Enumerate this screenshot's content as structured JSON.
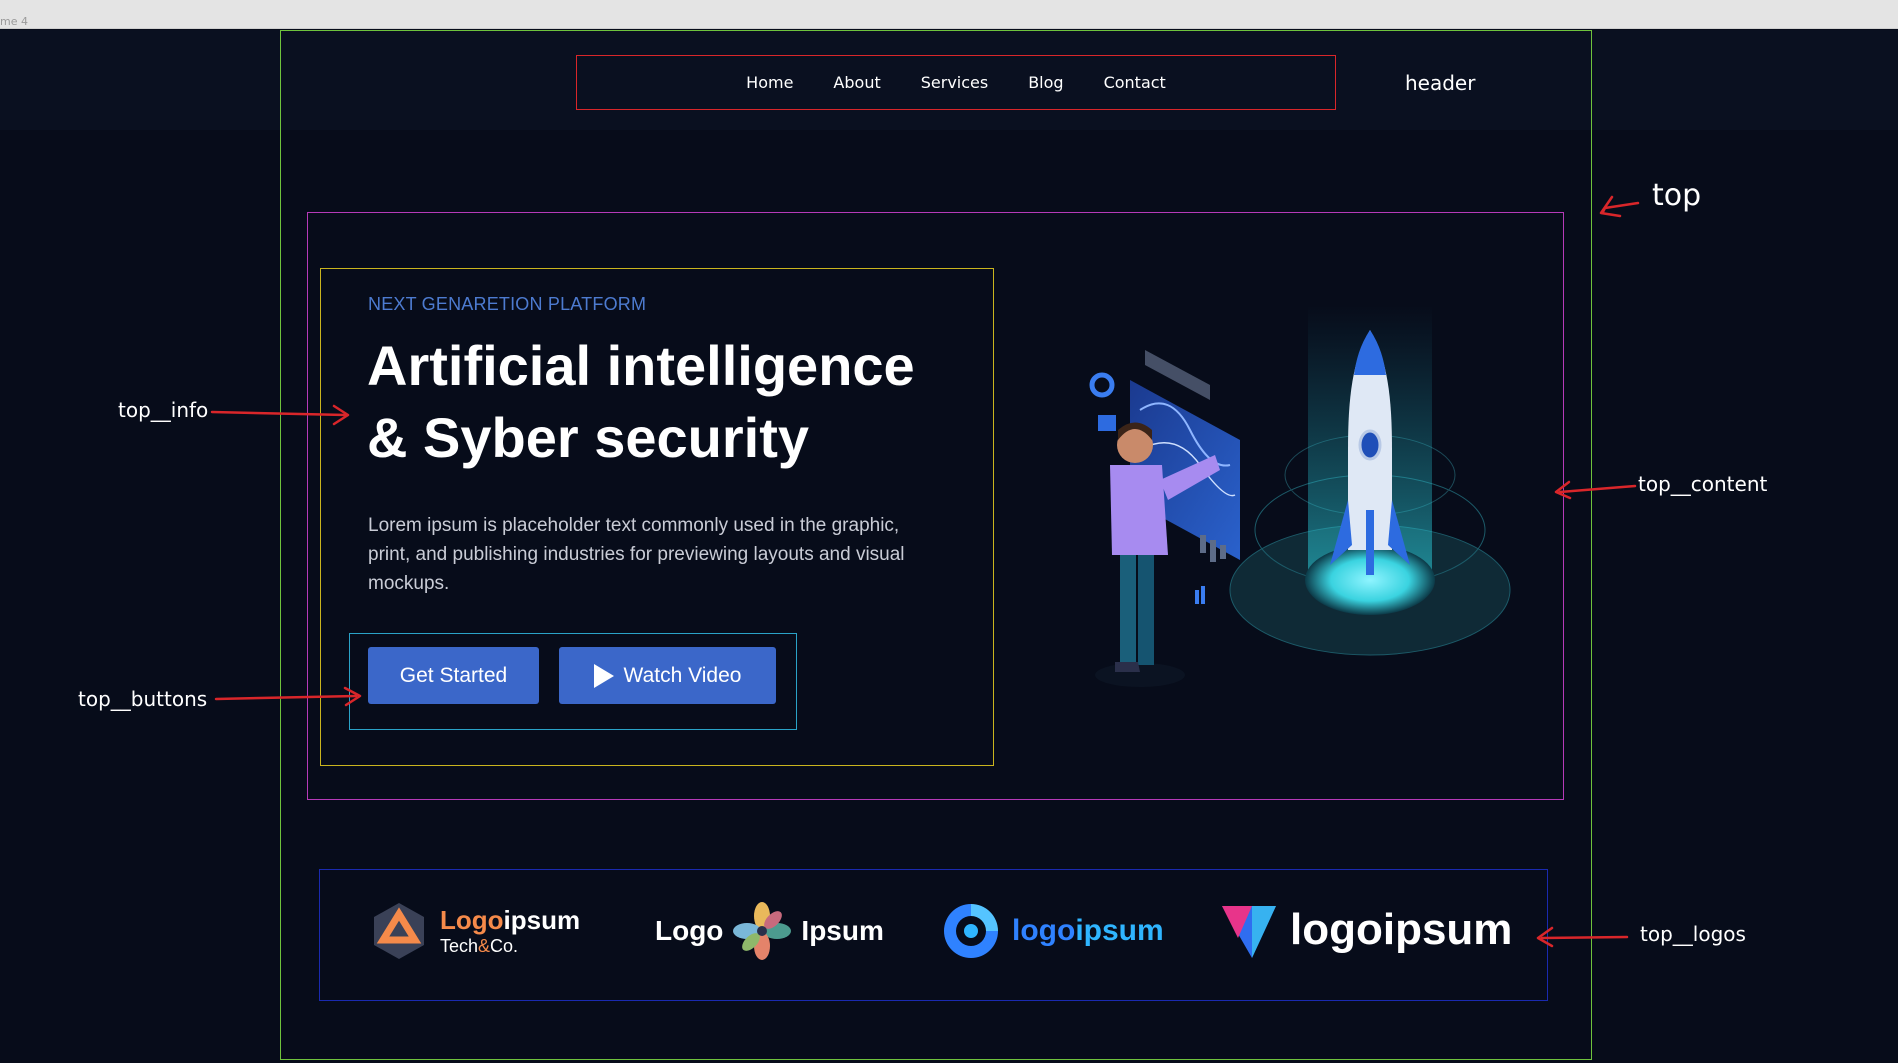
{
  "frame_label": "me 4",
  "nav": {
    "items": [
      {
        "label": "Home"
      },
      {
        "label": "About"
      },
      {
        "label": "Services"
      },
      {
        "label": "Blog"
      },
      {
        "label": "Contact"
      }
    ]
  },
  "annotations": {
    "header": "header",
    "top": "top",
    "top_info": "top__info",
    "top_content": "top__content",
    "top_buttons": "top__buttons",
    "top_logos": "top__logos"
  },
  "hero": {
    "eyebrow": "NEXT GENARETION PLATFORM",
    "title_line1": "Artificial intelligence",
    "title_line2": "& Syber security",
    "description": "Lorem ipsum is placeholder text commonly used in the graphic, print, and publishing industries for previewing layouts and visual mockups.",
    "primary_button": "Get Started",
    "secondary_button": "Watch Video"
  },
  "logos": {
    "logo1_a": "Logo",
    "logo1_b": "ipsum",
    "logo1_sub_a": "Tech",
    "logo1_sub_amp": "&",
    "logo1_sub_b": "Co.",
    "logo2_left": "Logo",
    "logo2_right": "Ipsum",
    "logo3_a": "logo",
    "logo3_b": "ipsum",
    "logo4": "logoipsum"
  },
  "colors": {
    "background": "#070c1a",
    "accent": "#3b67c9",
    "eyebrow": "#4d7bd0",
    "annotation_arrow": "#d9262a",
    "frame_green": "#6fc33d",
    "box_nav": "#d9262a",
    "box_top": "#b53ab8",
    "box_info": "#c9b41e",
    "box_buttons": "#2aa3c8",
    "box_logos": "#1a2ab0"
  },
  "icons": [
    "play-icon",
    "rocket-illustration",
    "person-illustration",
    "dashboard-illustration"
  ]
}
